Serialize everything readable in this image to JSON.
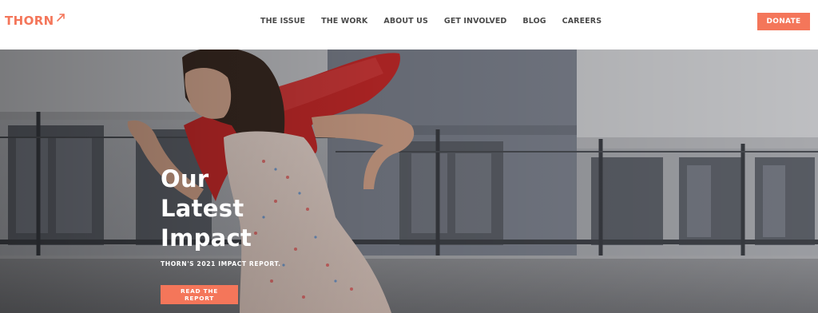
{
  "header": {
    "logo_text": "THORN",
    "nav": [
      {
        "label": "THE ISSUE"
      },
      {
        "label": "THE WORK"
      },
      {
        "label": "ABOUT US"
      },
      {
        "label": "GET INVOLVED"
      },
      {
        "label": "BLOG"
      },
      {
        "label": "CAREERS"
      }
    ],
    "donate_label": "DONATE"
  },
  "hero": {
    "title_lines": [
      "Our",
      "Latest",
      "Impact"
    ],
    "subtitle": "THORN'S 2021 IMPACT REPORT.",
    "cta_label": "READ THE REPORT"
  },
  "colors": {
    "accent": "#f4765a",
    "nav_text": "#4a4a4a",
    "header_bg": "#ffffff",
    "hero_text": "#ffffff"
  },
  "icons": {
    "logo_mark": "thorn-arrow-icon"
  }
}
